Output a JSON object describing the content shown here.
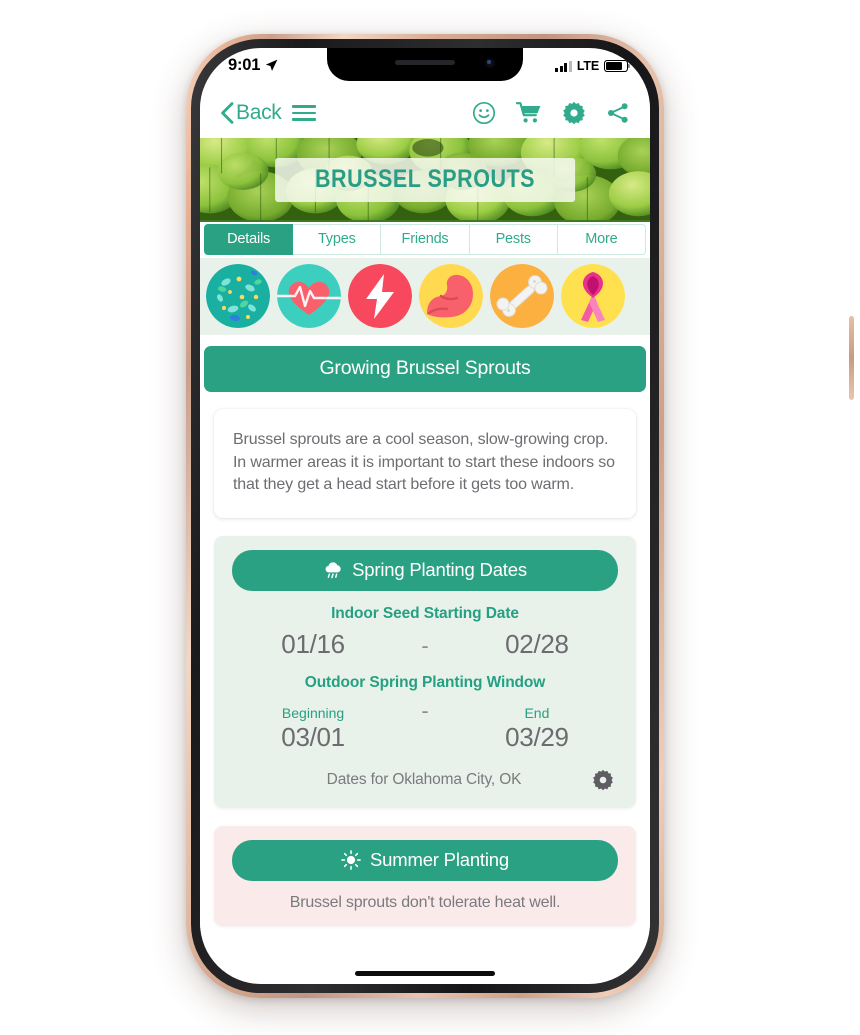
{
  "status_bar": {
    "time": "9:01",
    "location_icon": "location-arrow-icon",
    "network": "LTE",
    "signal_icon": "signal-bars-icon",
    "battery_icon": "battery-icon"
  },
  "nav_bar": {
    "back_label": "Back",
    "back_icon": "chevron-left-icon",
    "menu_icon": "hamburger-menu-icon",
    "actions": [
      {
        "name": "smiley-icon",
        "label": "Smiley"
      },
      {
        "name": "cart-icon",
        "label": "Cart"
      },
      {
        "name": "gear-icon",
        "label": "Settings"
      },
      {
        "name": "share-icon",
        "label": "Share"
      }
    ]
  },
  "hero": {
    "title": "BRUSSEL SPROUTS",
    "image_alt": "brussel-sprouts-photo"
  },
  "tabs": [
    {
      "label": "Details",
      "active": true
    },
    {
      "label": "Types",
      "active": false
    },
    {
      "label": "Friends",
      "active": false
    },
    {
      "label": "Pests",
      "active": false
    },
    {
      "label": "More",
      "active": false
    }
  ],
  "health_icons": [
    {
      "name": "microbiome-icon",
      "bg": "#1eb6a6"
    },
    {
      "name": "heart-pulse-icon",
      "bg": "#3ccfc0"
    },
    {
      "name": "energy-bolt-icon",
      "bg": "#f8485e"
    },
    {
      "name": "muscle-arm-icon",
      "bg": "#ffd84d"
    },
    {
      "name": "bone-icon",
      "bg": "#fbb040"
    },
    {
      "name": "cancer-ribbon-icon",
      "bg": "#ffe14d"
    }
  ],
  "section": {
    "header": "Growing Brussel Sprouts",
    "description": "Brussel sprouts are a cool season, slow-growing crop. In warmer areas it is important to start these indoors so that they get a head start before it gets too warm."
  },
  "spring": {
    "header": "Spring Planting Dates",
    "header_icon": "rain-cloud-icon",
    "indoor_label": "Indoor Seed Starting Date",
    "indoor_start": "01/16",
    "indoor_end": "02/28",
    "outdoor_label": "Outdoor Spring Planting Window",
    "begin_caption": "Beginning",
    "end_caption": "End",
    "outdoor_start": "03/01",
    "outdoor_end": "03/29",
    "dash": "-",
    "location_text": "Dates for Oklahoma City, OK",
    "location_gear_icon": "gear-icon"
  },
  "summer": {
    "header": "Summer Planting",
    "header_icon": "sun-icon",
    "note": "Brussel sprouts don't tolerate heat well."
  },
  "colors": {
    "teal": "#2ba183",
    "teal_text": "#30ab8b",
    "mint_card": "#e8f2ea",
    "pink_card": "#fbeaea",
    "body_text": "#6d6d72"
  }
}
